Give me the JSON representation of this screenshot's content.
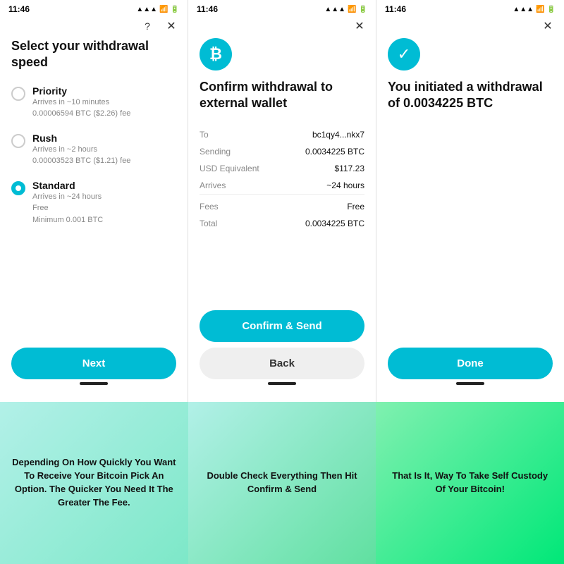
{
  "screens": [
    {
      "time": "11:46",
      "title": "Select your withdrawal speed",
      "options": [
        {
          "id": "priority",
          "label": "Priority",
          "sub1": "Arrives in ~10 minutes",
          "sub2": "0.00006594 BTC ($2.26) fee",
          "selected": false
        },
        {
          "id": "rush",
          "label": "Rush",
          "sub1": "Arrives in ~2 hours",
          "sub2": "0.00003523 BTC ($1.21) fee",
          "selected": false
        },
        {
          "id": "standard",
          "label": "Standard",
          "sub1": "Arrives in ~24 hours",
          "sub2": "Free",
          "sub3": "Minimum 0.001 BTC",
          "selected": true
        }
      ],
      "button": "Next",
      "caption": "Depending On How Quickly You Want To Receive Your Bitcoin Pick An Option. The Quicker You Need It The Greater The Fee."
    },
    {
      "time": "11:46",
      "title": "Confirm withdrawal to external wallet",
      "icon": "₿",
      "table": [
        {
          "label": "To",
          "value": "bc1qy4...nkx7"
        },
        {
          "label": "Sending",
          "value": "0.0034225 BTC"
        },
        {
          "label": "USD Equivalent",
          "value": "$117.23"
        },
        {
          "label": "Arrives",
          "value": "~24 hours"
        }
      ],
      "table2": [
        {
          "label": "Fees",
          "value": "Free"
        },
        {
          "label": "Total",
          "value": "0.0034225 BTC"
        }
      ],
      "primaryBtn": "Confirm & Send",
      "secondaryBtn": "Back",
      "caption": "Double Check Everything Then Hit Confirm & Send"
    },
    {
      "time": "11:46",
      "title": "You initiated a withdrawal of 0.0034225 BTC",
      "icon": "✓",
      "button": "Done",
      "caption": "That Is It, Way To Take Self Custody Of Your Bitcoin!"
    }
  ]
}
